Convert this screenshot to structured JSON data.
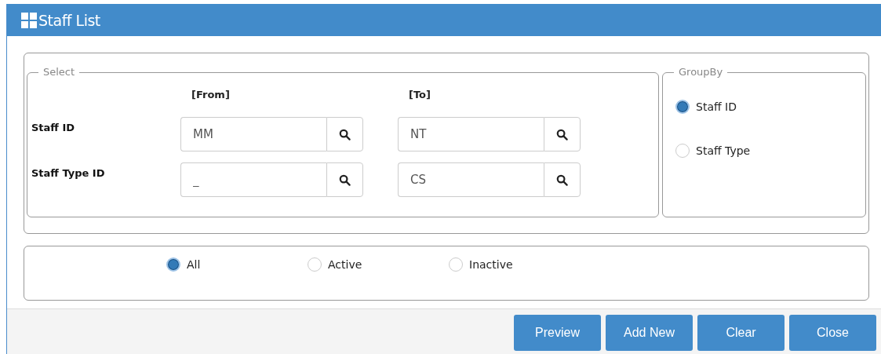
{
  "window": {
    "title": "Staff List"
  },
  "select": {
    "legend": "Select",
    "from_heading": "[From]",
    "to_heading": "[To]",
    "rows": [
      {
        "label": "Staff ID",
        "from": "MM",
        "to": "NT"
      },
      {
        "label": "Staff Type ID",
        "from": "_",
        "to": "CS"
      }
    ]
  },
  "group_by": {
    "legend": "GroupBy",
    "options": [
      {
        "label": "Staff ID",
        "selected": true
      },
      {
        "label": "Staff Type",
        "selected": false
      }
    ]
  },
  "status": {
    "options": [
      {
        "label": "All",
        "selected": true
      },
      {
        "label": "Active",
        "selected": false
      },
      {
        "label": "Inactive",
        "selected": false
      }
    ]
  },
  "buttons": [
    "Preview",
    "Add New",
    "Clear",
    "Close"
  ]
}
